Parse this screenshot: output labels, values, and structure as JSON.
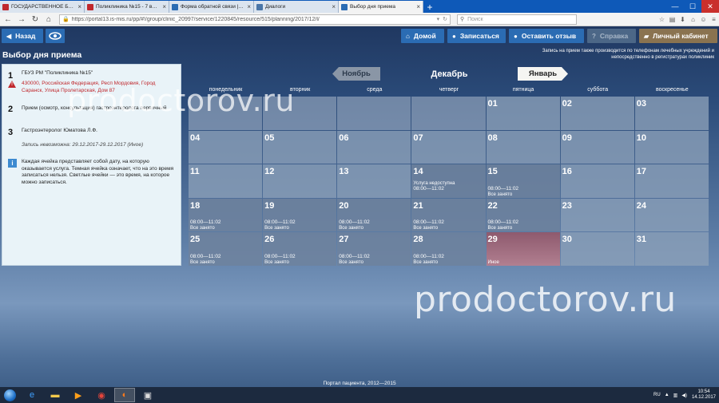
{
  "browser": {
    "tabs": [
      {
        "title": "ГОСУДАРСТВЕННОЕ БЮДЖЕТ",
        "color": "#c0282d"
      },
      {
        "title": "Поликлиника №15 - 7 врачей",
        "color": "#c0282d"
      },
      {
        "title": "Форма обратной связи | \"Поли",
        "color": "#2b6cb3"
      },
      {
        "title": "Диалоги",
        "color": "#4a76a8"
      },
      {
        "title": "Выбор дня приема",
        "color": "#2b6cb3"
      }
    ],
    "url": "https://portal13.is-mis.ru/pp/#!/group/clinic_20997/service/1220845/resource/515/planning/2017/12/l/",
    "search_placeholder": "Поиск"
  },
  "toolbar": {
    "back": "Назад",
    "home": "Домой",
    "sign_up": "Записаться",
    "feedback": "Оставить отзыв",
    "help": "Справка",
    "cabinet": "Личный кабинет"
  },
  "page_title": "Выбор дня приема",
  "notice": "Запись на прием также производится по телефонам лечебных учреждений и непосредственно в регистратурах поликлиник",
  "steps": {
    "s1_num": "1",
    "s1_name": "ГБУЗ РМ \"Поликлиника №15\"",
    "s1_addr": "430000, Российская Федерация, Респ Мордовия, Город Саранск, Улица Пролетарская, Дом 87",
    "s2_num": "2",
    "s2_text": "Прием (осмотр, консультация) гастроэнтеролога первичный",
    "s3_num": "3",
    "s3_doctor": "Гастроэнтеролог Юматова Л.Ф.",
    "s3_note": "Запись невозможна: 29.12.2017-29.12.2017 (Иное)",
    "info": "Каждая ячейка представляет собой дату, на которую оказывается услуга. Темная ячейка означает, что на это время записаться нельзя. Светлые ячейки — это время, на которое можно записаться."
  },
  "calendar": {
    "prev": "Ноябрь",
    "current": "Декабрь",
    "next": "Январь",
    "weekdays": [
      "понедельник",
      "вторник",
      "среда",
      "четверг",
      "пятница",
      "суббота",
      "воскресенье"
    ],
    "weeks": [
      [
        {
          "n": ""
        },
        {
          "n": ""
        },
        {
          "n": ""
        },
        {
          "n": ""
        },
        {
          "n": "01"
        },
        {
          "n": "02"
        },
        {
          "n": "03"
        }
      ],
      [
        {
          "n": "04"
        },
        {
          "n": "05"
        },
        {
          "n": "06"
        },
        {
          "n": "07"
        },
        {
          "n": "08"
        },
        {
          "n": "09"
        },
        {
          "n": "10"
        }
      ],
      [
        {
          "n": "11"
        },
        {
          "n": "12"
        },
        {
          "n": "13"
        },
        {
          "n": "14",
          "l0": "Услуга недоступна",
          "l1": "08:00—11:02"
        },
        {
          "n": "15",
          "l1": "08:00—11:02",
          "l2": "Все занято"
        },
        {
          "n": "16"
        },
        {
          "n": "17"
        }
      ],
      [
        {
          "n": "18",
          "l1": "08:00—11:02",
          "l2": "Все занято"
        },
        {
          "n": "19",
          "l1": "08:00—11:02",
          "l2": "Все занято"
        },
        {
          "n": "20",
          "l1": "08:00—11:02",
          "l2": "Все занято"
        },
        {
          "n": "21",
          "l1": "08:00—11:02",
          "l2": "Все занято"
        },
        {
          "n": "22",
          "l1": "08:00—11:02",
          "l2": "Все занято"
        },
        {
          "n": "23"
        },
        {
          "n": "24"
        }
      ],
      [
        {
          "n": "25",
          "l1": "08:00—11:02",
          "l2": "Все занято"
        },
        {
          "n": "26",
          "l1": "08:00—11:02",
          "l2": "Все занято"
        },
        {
          "n": "27",
          "l1": "08:00—11:02",
          "l2": "Все занято"
        },
        {
          "n": "28",
          "l1": "08:00—11:02",
          "l2": "Все занято"
        },
        {
          "n": "29",
          "l1": "Иное",
          "special": "pink"
        },
        {
          "n": "30"
        },
        {
          "n": "31"
        }
      ]
    ]
  },
  "watermark": "prodoctorov.ru",
  "footer": "Портал пациента, 2012—2015",
  "taskbar": {
    "lang": "RU",
    "time": "10:54",
    "date": "14.12.2017"
  }
}
